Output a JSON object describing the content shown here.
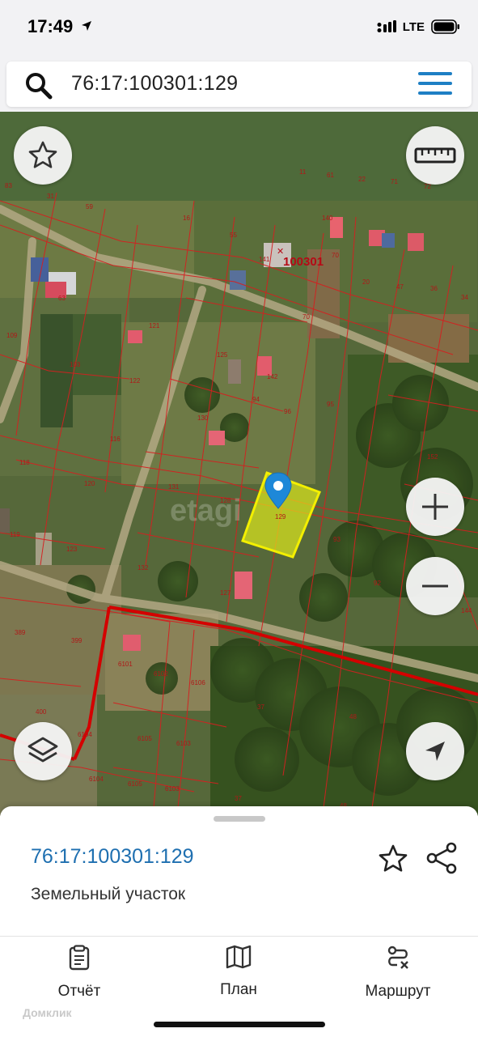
{
  "status": {
    "time": "17:49",
    "network": "LTE"
  },
  "search": {
    "query": "76:17:100301:129"
  },
  "map": {
    "quarter_label": "100301",
    "selected_parcel_label": "129",
    "watermark": "etagi",
    "parcel_labels": [
      "83",
      "31",
      "59",
      "16",
      "55",
      "11",
      "61",
      "22",
      "71",
      "72",
      "141",
      "140",
      "70",
      "20",
      "47",
      "36",
      "34",
      "63",
      "121",
      "125",
      "142",
      "70",
      "103",
      "109",
      "122",
      "94",
      "130",
      "96",
      "95",
      "116",
      "118",
      "120",
      "131",
      "128",
      "152",
      "119",
      "123",
      "93",
      "132",
      "127",
      "129",
      "92",
      "144",
      "389",
      "399",
      "6101",
      "6102",
      "6106",
      "37",
      "400",
      "48",
      "6104",
      "6105",
      "6103",
      "6104",
      "6105",
      "6103",
      "37",
      "48"
    ],
    "controls": {
      "favorite": "star-icon",
      "ruler": "ruler-icon",
      "zoom_in": "plus-icon",
      "zoom_out": "minus-icon",
      "layers": "layers-icon",
      "locate": "location-arrow-icon"
    },
    "colors": {
      "parcel_border": "#d42020",
      "selected_fill": "#e8f21a",
      "selected_border": "#f3ef00",
      "pin": "#1e88d8",
      "quarter_border": "#d40000"
    }
  },
  "sheet": {
    "title": "76:17:100301:129",
    "subtitle": "Земельный участок"
  },
  "tabs": [
    {
      "label": "Отчёт",
      "icon": "clipboard-icon"
    },
    {
      "label": "План",
      "icon": "map-icon"
    },
    {
      "label": "Маршрут",
      "icon": "route-icon"
    }
  ],
  "footer": {
    "watermark": "Домклик"
  }
}
